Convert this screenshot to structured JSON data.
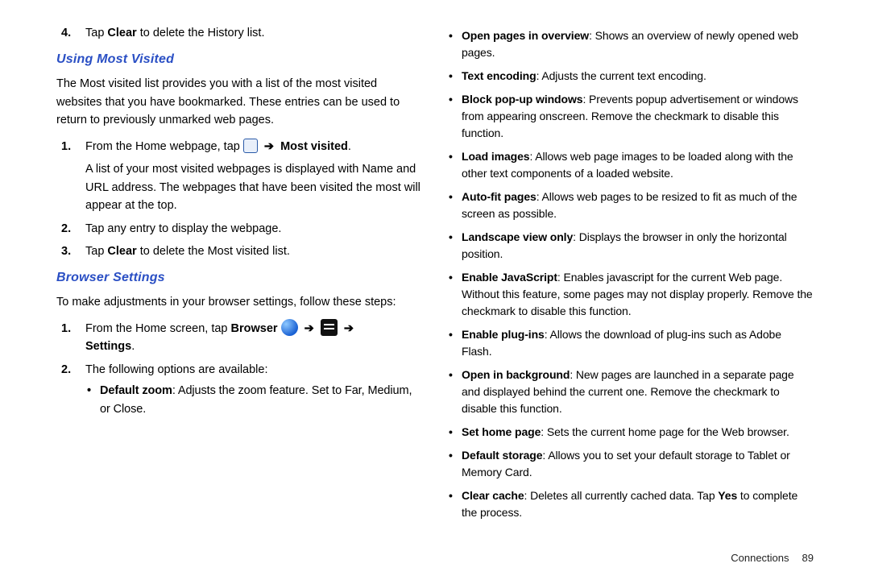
{
  "left": {
    "step4_prefix": "Tap ",
    "step4_bold": "Clear",
    "step4_suffix": " to delete the History list.",
    "heading_mv": "Using Most Visited",
    "mv_intro": "The Most visited list provides you with a list of the most visited websites that you have bookmarked. These entries can be used to return to previously unmarked web pages.",
    "mv1_prefix": "From the Home webpage, tap ",
    "mv1_bold": "Most visited",
    "mv1_sub1": "A list of your most visited webpages is displayed with Name and URL address. The webpages that have been visited the most will appear at the top.",
    "mv2": "Tap any entry to display the webpage.",
    "mv3_prefix": " Tap ",
    "mv3_bold": "Clear",
    "mv3_suffix": " to delete the Most visited list.",
    "heading_bs": "Browser Settings",
    "bs_intro": "To make adjustments in your browser settings, follow these steps:",
    "bs1_prefix": "From the Home screen, tap ",
    "bs1_bold_browser": "Browser",
    "bs1_bold_settings": "Settings",
    "bs2": "The following options are available:",
    "opt_default_zoom_t": "Default zoom",
    "opt_default_zoom_d": ": Adjusts the zoom feature. Set to Far, Medium, or Close."
  },
  "right": {
    "items": [
      {
        "t": "Open pages in overview",
        "d": ": Shows an overview of newly opened web pages."
      },
      {
        "t": "Text encoding",
        "d": ": Adjusts the current text encoding."
      },
      {
        "t": "Block pop-up windows",
        "d": ": Prevents popup advertisement or windows from appearing onscreen. Remove the checkmark to disable this function."
      },
      {
        "t": "Load images",
        "d": ": Allows web page images to be loaded along with the other text components of a loaded website."
      },
      {
        "t": "Auto-fit pages",
        "d": ": Allows web pages to be resized to fit as much of the screen as possible."
      },
      {
        "t": "Landscape view only",
        "d": ": Displays the browser in only the horizontal position."
      },
      {
        "t": "Enable JavaScript",
        "d": ": Enables javascript for the current Web page. Without this feature, some pages may not display properly. Remove the checkmark to disable this function."
      },
      {
        "t": "Enable plug-ins",
        "d": ": Allows the download of plug-ins such as Adobe Flash."
      },
      {
        "t": "Open in background",
        "d": ": New pages are launched in a separate page and displayed behind the current one. Remove the checkmark to disable this function."
      },
      {
        "t": "Set home page",
        "d": ": Sets the current home page for the Web browser."
      },
      {
        "t": "Default storage",
        "d": ": Allows you to set your default storage to Tablet or Memory Card."
      }
    ],
    "clear_cache_t": "Clear cache",
    "clear_cache_d1": ": Deletes all currently cached data. Tap ",
    "clear_cache_yes": "Yes",
    "clear_cache_d2": " to complete the process."
  },
  "footer": {
    "section": "Connections",
    "page": "89"
  }
}
